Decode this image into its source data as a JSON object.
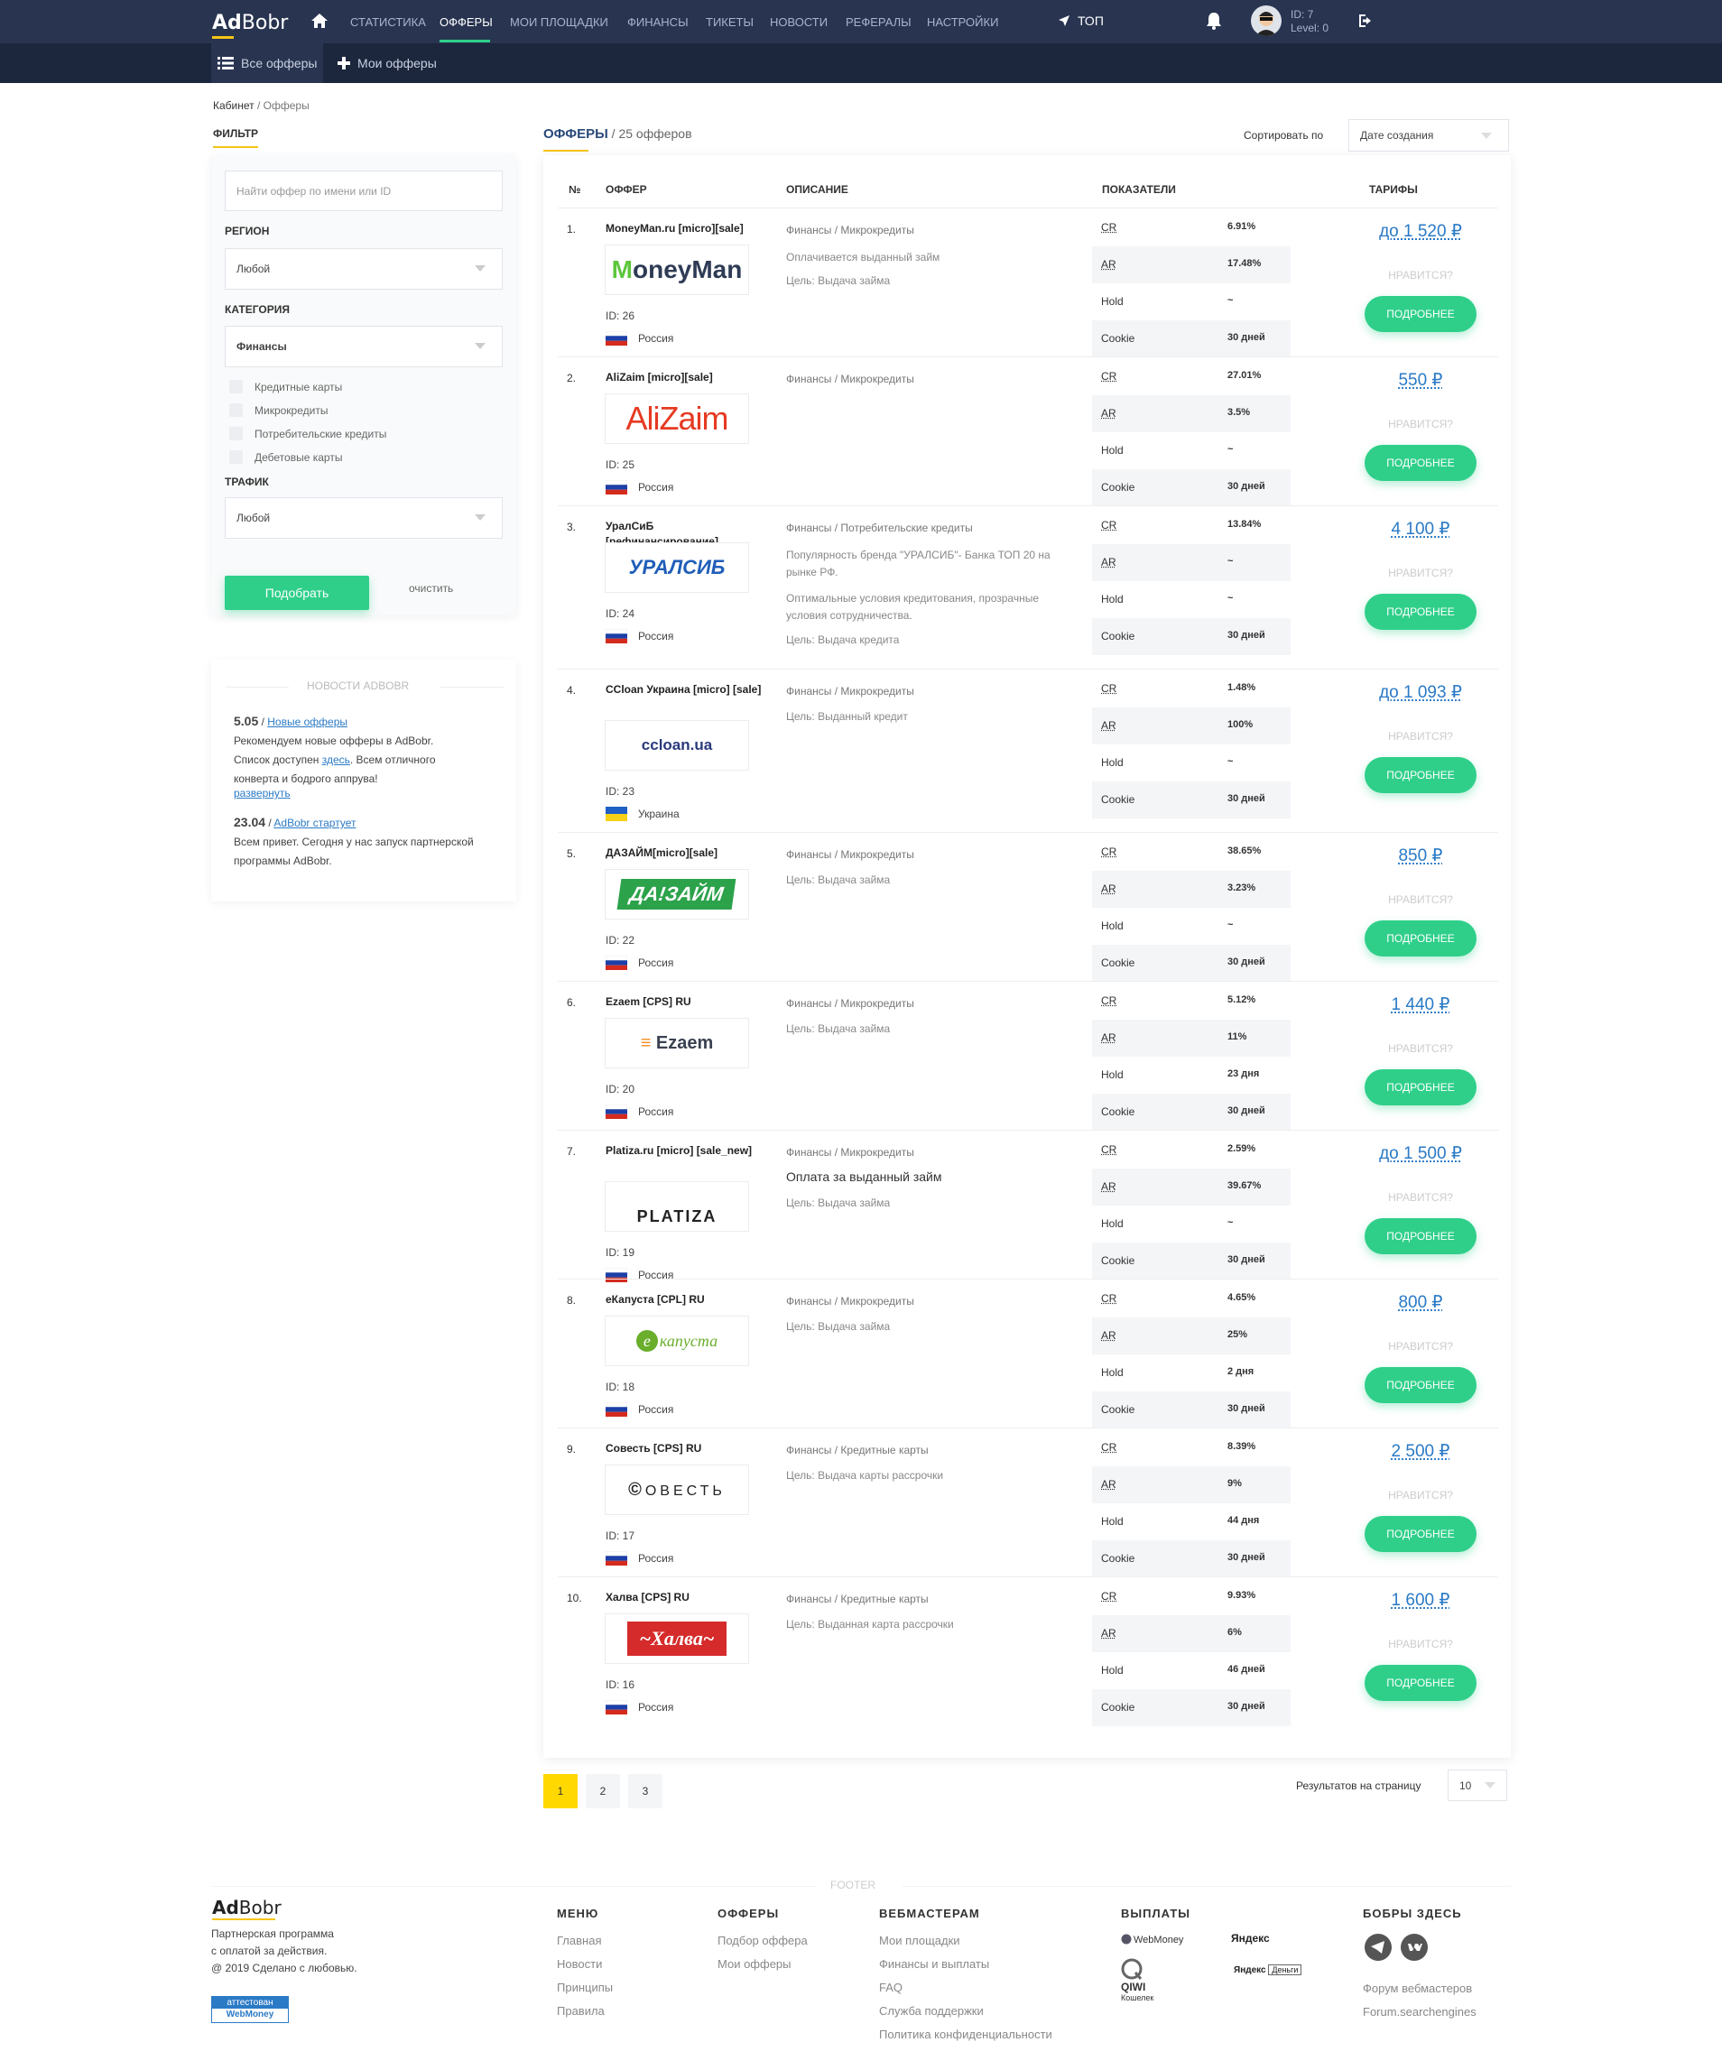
{
  "app": {
    "logo_bold": "Ad",
    "logo_rest": "Bobr"
  },
  "nav": [
    "СТАТИСТИКА",
    "ОФФЕРЫ",
    "МОИ ПЛОЩАДКИ",
    "ФИНАНСЫ",
    "ТИКЕТЫ",
    "НОВОСТИ",
    "РЕФЕРАЛЫ",
    "НАСТРОЙКИ"
  ],
  "top_label": "ТОП",
  "user": {
    "id": "ID: 7",
    "level": "Level: 0"
  },
  "subnav": {
    "all": "Все офферы",
    "mine": "Мои офферы"
  },
  "breadcrumb": {
    "home": "Кабинет",
    "sep": " / ",
    "current": "Офферы"
  },
  "filter": {
    "title": "ФИЛЬТР",
    "search_placeholder": "Найти оффер по имени или ID",
    "region_label": "РЕГИОН",
    "region_value": "Любой",
    "category_label": "КАТЕГОРИЯ",
    "category_value": "Финансы",
    "subcategories": [
      "Кредитные карты",
      "Микрокредиты",
      "Потребительские кредиты",
      "Дебетовые карты"
    ],
    "traffic_label": "ТРАФИК",
    "traffic_value": "Любой",
    "submit": "Подобрать",
    "clear": "очистить"
  },
  "news": {
    "title": "НОВОСТИ ADBOBR",
    "items": [
      {
        "date": "5.05",
        "sep": " / ",
        "link": "Новые офферы",
        "text1": "Рекомендуем новые офферы в AdBobr.",
        "text2a": "Список доступен ",
        "text2link": "здесь",
        "text2b": ". Всем отличного",
        "text3": "конверта и бодрого аппрува!",
        "expand": "развернуть"
      },
      {
        "date": "23.04",
        "sep": " / ",
        "link": "AdBobr стартует",
        "text1": "Всем привет. Сегодня у нас запуск партнерской",
        "text2": "программы AdBobr."
      }
    ]
  },
  "offers_header": {
    "title": "ОФФЕРЫ",
    "count": " / 25 офферов",
    "sort_label": "Сортировать по",
    "sort_value": "Дате создания"
  },
  "columns": {
    "no": "№",
    "offer": "ОФФЕР",
    "desc": "ОПИСАНИЕ",
    "stats": "ПОКАЗАТЕЛИ",
    "rates": "ТАРИФЫ"
  },
  "labels": {
    "cr": "CR",
    "ar": "AR",
    "hold": "Hold",
    "cookie": "Cookie",
    "like": "НРАВИТСЯ?",
    "more": "ПОДРОБНЕЕ",
    "goal": "Цель:"
  },
  "offers": [
    {
      "n": "1.",
      "title": "MoneyMan.ru [micro][sale]",
      "logo": "MoneyMan",
      "id": "ID: 26",
      "country": "Россия",
      "cat": "Финансы",
      "sub": "Микрокредиты",
      "desc": [
        "Оплачивается выданный займ"
      ],
      "goal": "Выдача займа",
      "cr": "6.91%",
      "ar": "17.48%",
      "hold": "~",
      "cookie": "30 дней",
      "price": "до 1 520 ₽"
    },
    {
      "n": "2.",
      "title": "AliZaim [micro][sale]",
      "logo": "AliZaim",
      "id": "ID: 25",
      "country": "Россия",
      "cat": "Финансы",
      "sub": "Микрокредиты",
      "desc": [],
      "goal": "",
      "cr": "27.01%",
      "ar": "3.5%",
      "hold": "~",
      "cookie": "30 дней",
      "price": "550 ₽"
    },
    {
      "n": "3.",
      "title": "УралСиБ [рефинансирование]",
      "logo": "УРАЛСИБ",
      "id": "ID: 24",
      "country": "Россия",
      "cat": "Финансы",
      "sub": "Потребительские кредиты",
      "desc": [
        "Популярность бренда \"УРАЛСИБ\"- Банка ТОП 20 на рынке РФ.",
        "Оптимальные условия кредитования, прозрачные условия сотрудничества."
      ],
      "goal": "Выдача кредита",
      "cr": "13.84%",
      "ar": "~",
      "hold": "~",
      "cookie": "30 дней",
      "price": "4 100 ₽"
    },
    {
      "n": "4.",
      "title": "CCloan Украина [micro] [sale]",
      "logo": "ccloan.ua",
      "id": "ID: 23",
      "country": "Украина",
      "cat": "Финансы",
      "sub": "Микрокредиты",
      "desc": [],
      "goal": "Выданный кредит",
      "cr": "1.48%",
      "ar": "100%",
      "hold": "~",
      "cookie": "30 дней",
      "price": "до 1 093 ₽"
    },
    {
      "n": "5.",
      "title": "ДАЗАЙМ[micro][sale]",
      "logo": "ДА!ЗАЙМ",
      "id": "ID: 22",
      "country": "Россия",
      "cat": "Финансы",
      "sub": "Микрокредиты",
      "desc": [],
      "goal": "Выдача займа",
      "cr": "38.65%",
      "ar": "3.23%",
      "hold": "~",
      "cookie": "30 дней",
      "price": "850 ₽"
    },
    {
      "n": "6.",
      "title": "Ezaem [CPS] RU",
      "logo": "Ezaem",
      "id": "ID: 20",
      "country": "Россия",
      "cat": "Финансы",
      "sub": "Микрокредиты",
      "desc": [],
      "goal": "Выдача займа",
      "cr": "5.12%",
      "ar": "11%",
      "hold": "23 дня",
      "cookie": "30 дней",
      "price": "1 440 ₽"
    },
    {
      "n": "7.",
      "title": "Platiza.ru [micro] [sale_new]",
      "logo": "PLATIZA",
      "id": "ID: 19",
      "country": "Россия",
      "cat": "Финансы",
      "sub": "Микрокредиты",
      "desc_big": "Оплата за выданный займ",
      "desc": [],
      "goal": "Выдача займа",
      "cr": "2.59%",
      "ar": "39.67%",
      "hold": "~",
      "cookie": "30 дней",
      "price": "до 1 500 ₽"
    },
    {
      "n": "8.",
      "title": "еКапуста [CPL] RU",
      "logo": "капуста",
      "id": "ID: 18",
      "country": "Россия",
      "cat": "Финансы",
      "sub": "Микрокредиты",
      "desc": [],
      "goal": "Выдача займа",
      "cr": "4.65%",
      "ar": "25%",
      "hold": "2 дня",
      "cookie": "30 дней",
      "price": "800 ₽"
    },
    {
      "n": "9.",
      "title": "Совесть [CPS] RU",
      "logo": "ОВЕСТЬ",
      "id": "ID: 17",
      "country": "Россия",
      "cat": "Финансы",
      "sub": "Кредитные карты",
      "desc": [],
      "goal": "Выдача карты рассрочки",
      "cr": "8.39%",
      "ar": "9%",
      "hold": "44 дня",
      "cookie": "30 дней",
      "price": "2 500 ₽"
    },
    {
      "n": "10.",
      "title": "Халва [CPS] RU",
      "logo": "~Халва~",
      "id": "ID: 16",
      "country": "Россия",
      "cat": "Финансы",
      "sub": "Кредитные карты",
      "desc": [],
      "goal": "Выданная карта рассрочки",
      "cr": "9.93%",
      "ar": "6%",
      "hold": "46 дней",
      "cookie": "30 дней",
      "price": "1 600 ₽"
    }
  ],
  "pagination": {
    "pages": [
      "1",
      "2",
      "3"
    ],
    "current": "1",
    "per_page_label": "Результатов на страницу",
    "per_page": "10"
  },
  "footer": {
    "label": "FOOTER",
    "about": [
      "Партнерская программа",
      "с оплатой за действия.",
      "@ 2019 Сделано с любовью."
    ],
    "badge": [
      "аттестован",
      "WebMoney"
    ],
    "menu": {
      "title": "МЕНЮ",
      "items": [
        "Главная",
        "Новости",
        "Принципы",
        "Правила"
      ]
    },
    "offers": {
      "title": "ОФФЕРЫ",
      "items": [
        "Подбор оффера",
        "Мои офферы"
      ]
    },
    "webmasters": {
      "title": "ВЕБМАСТЕРАМ",
      "items": [
        "Мои площадки",
        "Финансы и выплаты",
        "FAQ",
        "Служба поддержки",
        "Политика конфиденциальности"
      ]
    },
    "payouts": {
      "title": "ВЫПЛАТЫ",
      "items": [
        "WebMoney",
        "Яндекс",
        "QIWI",
        "Кошелек",
        "Яндекс",
        "Деньги"
      ]
    },
    "bobrs": {
      "title": "БОБРЫ ЗДЕСЬ",
      "items": [
        "Форум вебмастеров",
        "Forum.searchengines"
      ]
    }
  },
  "colors": {
    "nav_bg": "#283450",
    "subnav_bg": "#1c263d",
    "accent_green": "#2fcf8a",
    "accent_yellow": "#f5c518",
    "link_blue": "#2a7ac6"
  }
}
